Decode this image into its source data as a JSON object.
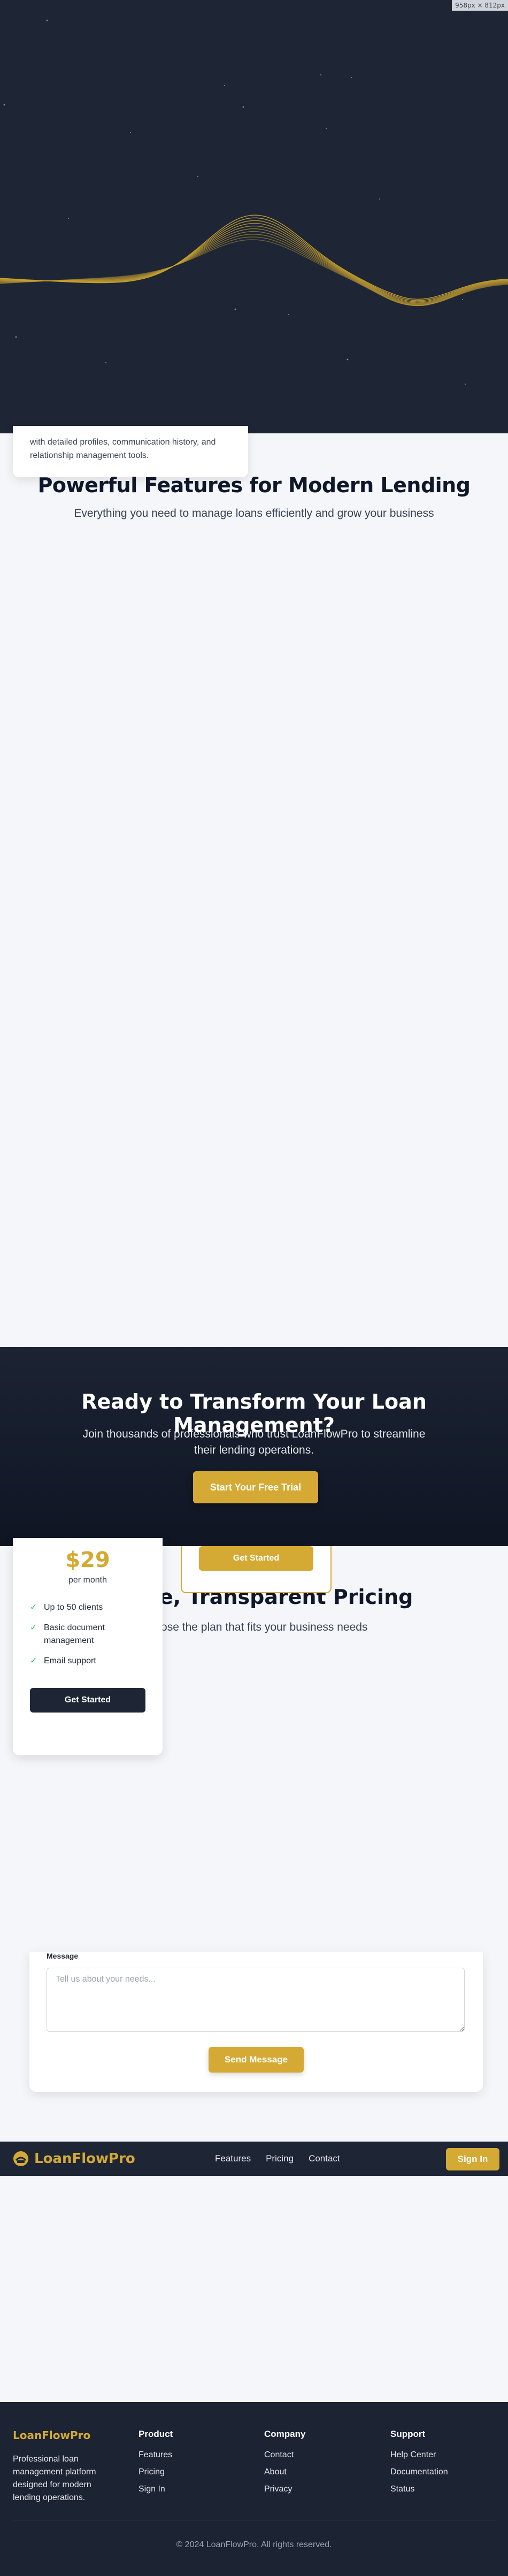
{
  "meta": {
    "size_badge": "958px × 812px"
  },
  "colors": {
    "accent": "#d4aa34",
    "dark": "#1e2636",
    "check": "#22c55e"
  },
  "feature_card": {
    "text": "with detailed profiles, communication history, and relationship management tools."
  },
  "features": {
    "title": "Powerful Features for Modern Lending",
    "subtitle": "Everything you need to manage loans efficiently and grow your business"
  },
  "cta": {
    "title": "Ready to Transform Your Loan Management?",
    "subtitle": "Join thousands of professionals who trust LoanFlowPro to streamline their lending operations.",
    "button": "Start Your Free Trial"
  },
  "pricing": {
    "title": "Simple, Transparent Pricing",
    "subtitle": "Choose the plan that fits your business needs",
    "plan_basic": {
      "price": "$29",
      "period": "per month",
      "features": [
        "Up to 50 clients",
        "Basic document management",
        "Email support"
      ],
      "button": "Get Started",
      "check_icon": "check-icon"
    },
    "plan_pro": {
      "button": "Get Started"
    }
  },
  "contact": {
    "message_label": "Message",
    "message_placeholder": "Tell us about your needs...",
    "send_button": "Send Message"
  },
  "navbar": {
    "brand": "LoanFlowPro",
    "logo_icon": "brand-logo-icon",
    "links": [
      "Features",
      "Pricing",
      "Contact"
    ],
    "signin": "Sign In"
  },
  "footer": {
    "brand": "LoanFlowPro",
    "description": "Professional loan management platform designed for modern lending operations.",
    "columns": [
      {
        "title": "Product",
        "links": [
          "Features",
          "Pricing",
          "Sign In"
        ]
      },
      {
        "title": "Company",
        "links": [
          "Contact",
          "About",
          "Privacy"
        ]
      },
      {
        "title": "Support",
        "links": [
          "Help Center",
          "Documentation",
          "Status"
        ]
      }
    ],
    "copyright": "© 2024 LoanFlowPro. All rights reserved."
  }
}
